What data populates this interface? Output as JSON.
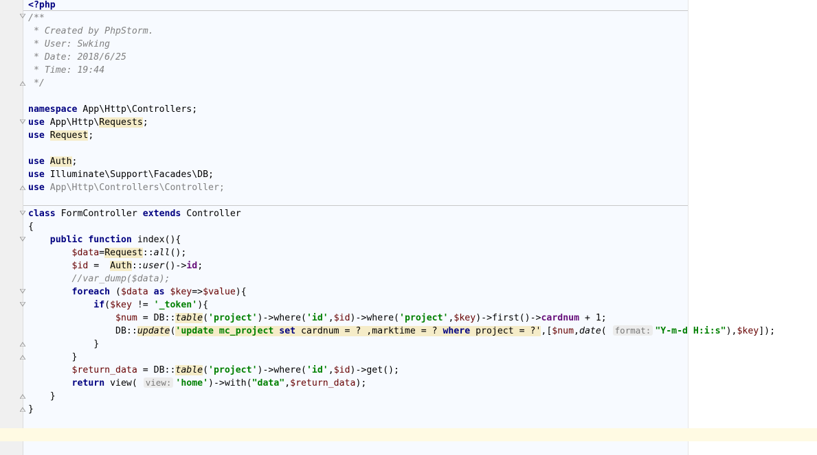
{
  "editor": {
    "open_tag": "<?php",
    "doc": [
      "/**",
      " * Created by PhpStorm.",
      " * User: Swking",
      " * Date: 2018/6/25",
      " * Time: 19:44",
      " */"
    ],
    "namespace": {
      "kw": "namespace",
      "name": "App\\Http\\Controllers;"
    },
    "uses": [
      {
        "kw": "use",
        "prefix": "App\\Http\\",
        "hl": "Requests",
        "suffix": ";"
      },
      {
        "kw": "use",
        "prefix": "",
        "hl": "Request",
        "suffix": ";"
      },
      {
        "kw": "use",
        "prefix": "",
        "hl": "Auth",
        "suffix": ";"
      },
      {
        "kw": "use",
        "prefix": "Illuminate\\Support\\Facades\\DB;",
        "hl": "",
        "suffix": ""
      },
      {
        "kw": "use",
        "prefix": "",
        "hl": "",
        "suffix": "",
        "unused": "App\\Http\\Controllers\\Controller;"
      }
    ],
    "class_decl": {
      "kw1": "class",
      "name": "FormController",
      "kw2": "extends",
      "parent": "Controller"
    },
    "brace_open": "{",
    "brace_close": "}",
    "method": {
      "kw1": "public",
      "kw2": "function",
      "sig": "index(){"
    },
    "l_data": {
      "var": "$data",
      "eq": "=",
      "cls": "Request",
      "sep": "::",
      "fn": "all",
      "tail": "();"
    },
    "l_id": {
      "var": "$id",
      "eq": " =  ",
      "cls": "Auth",
      "sep": "::",
      "fn": "user",
      "mid": "()->",
      "prop": "id",
      "tail": ";"
    },
    "l_comment": "//var_dump($data);",
    "l_foreach": {
      "kw": "foreach",
      "p1": " (",
      "v1": "$data",
      "kw2": " as ",
      "v2": "$key",
      "arrow": "=>",
      "v3": "$value",
      "tail": "){"
    },
    "l_if": {
      "kw": "if",
      "p1": "(",
      "v1": "$key",
      "op": " != ",
      "s1": "'_token'",
      "tail": "){"
    },
    "l_num": {
      "var": "$num",
      "eq": " = DB::",
      "fn": "table",
      "p1": "(",
      "s1": "'project'",
      "p2": ")->where(",
      "s2": "'id'",
      "c1": ",",
      "v1": "$id",
      "p3": ")->where(",
      "s3": "'project'",
      "c2": ",",
      "v2": "$key",
      "p4": ")->first()->",
      "prop": "cardnum",
      "tail": " + 1;"
    },
    "l_update": {
      "pre": "DB::",
      "fn": "update",
      "p1": "(",
      "q1": "'update mc_project ",
      "k1": "set",
      "q2": " cardnum = ? ,marktime = ? ",
      "k2": "where",
      "q3": " project = ?'",
      "p2": ",[",
      "v1": "$num",
      "c1": ",",
      "fn2": "date",
      "p3": "( ",
      "hint": "format:",
      "s1": "\"Y-m-d H:i:s\"",
      "p4": "),",
      "v2": "$key",
      "tail": "]);"
    },
    "l_return_data": {
      "var": "$return_data",
      "eq": " = DB::",
      "fn": "table",
      "p1": "(",
      "s1": "'project'",
      "p2": ")->where(",
      "s2": "'id'",
      "c1": ",",
      "v1": "$id",
      "tail": ")->get();"
    },
    "l_return": {
      "kw": "return",
      "p1": " view( ",
      "hint": "view:",
      "s1": "'home'",
      "p2": ")->with(",
      "s2": "\"data\"",
      "c1": ",",
      "v1": "$return_data",
      "tail": ");"
    }
  }
}
